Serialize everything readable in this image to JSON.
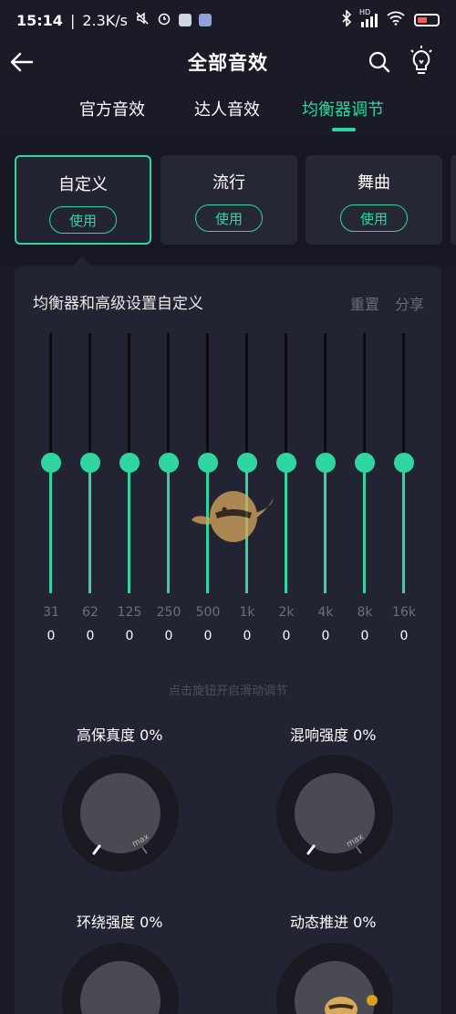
{
  "status_bar": {
    "time": "15:14",
    "speed": "2.3K/s",
    "icons": [
      "mute-icon",
      "alarm-icon",
      "app-icon",
      "app-icon",
      "bluetooth-icon",
      "signal-icon",
      "wifi-icon",
      "battery-icon"
    ],
    "network": "HD"
  },
  "header": {
    "title": "全部音效",
    "icons": [
      "back-arrow-icon",
      "search-icon",
      "lightbulb-icon"
    ]
  },
  "tabs": [
    {
      "label": "官方音效",
      "active": false
    },
    {
      "label": "达人音效",
      "active": false
    },
    {
      "label": "均衡器调节",
      "active": true
    }
  ],
  "presets": [
    {
      "name": "自定义",
      "use_label": "使用",
      "selected": true
    },
    {
      "name": "流行",
      "use_label": "使用",
      "selected": false
    },
    {
      "name": "舞曲",
      "use_label": "使用",
      "selected": false
    }
  ],
  "equalizer": {
    "title": "均衡器和高级设置自定义",
    "reset_label": "重置",
    "share_label": "分享",
    "bands": [
      {
        "freq": "31",
        "value": "0"
      },
      {
        "freq": "62",
        "value": "0"
      },
      {
        "freq": "125",
        "value": "0"
      },
      {
        "freq": "250",
        "value": "0"
      },
      {
        "freq": "500",
        "value": "0"
      },
      {
        "freq": "1k",
        "value": "0"
      },
      {
        "freq": "2k",
        "value": "0"
      },
      {
        "freq": "4k",
        "value": "0"
      },
      {
        "freq": "8k",
        "value": "0"
      },
      {
        "freq": "16k",
        "value": "0"
      }
    ],
    "hint": "点击旋钮开启滑动调节"
  },
  "dials": [
    {
      "label": "高保真度 0%",
      "max_label": "max"
    },
    {
      "label": "混响强度 0%",
      "max_label": "max"
    },
    {
      "label": "环绕强度 0%",
      "max_label": "max"
    },
    {
      "label": "动态推进 0%",
      "max_label": "max"
    }
  ],
  "colors": {
    "accent": "#2fd69f",
    "background": "#1a1b27",
    "panel": "#232433",
    "card": "#262735",
    "muted_text": "#6e6f7e"
  }
}
